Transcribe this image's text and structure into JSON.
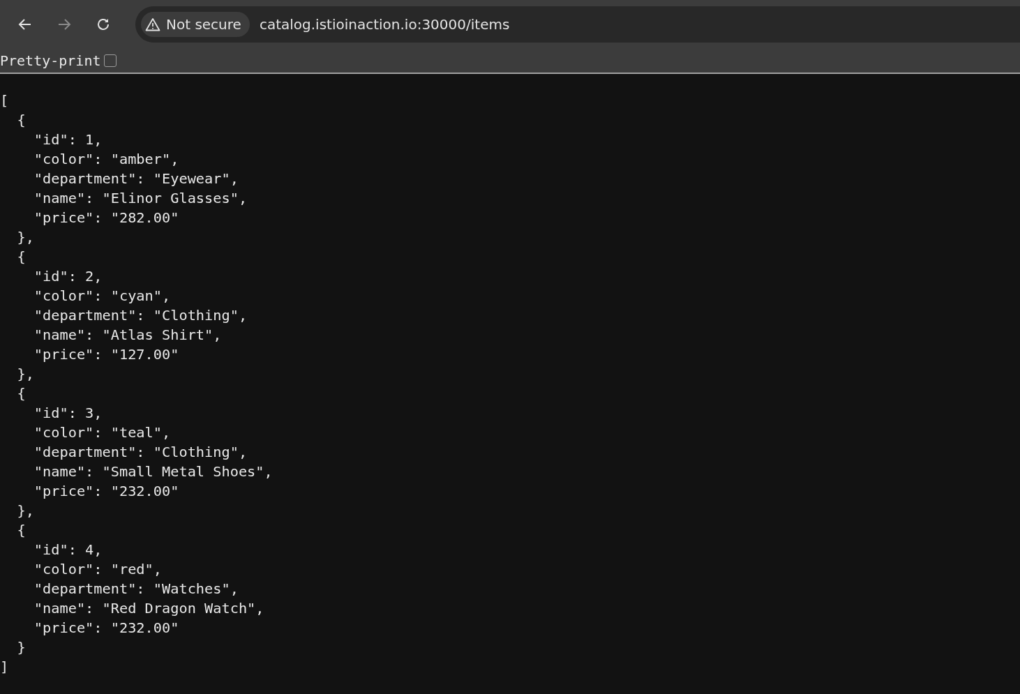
{
  "browser": {
    "security_label": "Not secure",
    "url": "catalog.istioinaction.io:30000/items"
  },
  "pretty_print": {
    "label": "Pretty-print",
    "checked": false
  },
  "json_lines": [
    "[",
    "  {",
    "    \"id\": 1,",
    "    \"color\": \"amber\",",
    "    \"department\": \"Eyewear\",",
    "    \"name\": \"Elinor Glasses\",",
    "    \"price\": \"282.00\"",
    "  },",
    "  {",
    "    \"id\": 2,",
    "    \"color\": \"cyan\",",
    "    \"department\": \"Clothing\",",
    "    \"name\": \"Atlas Shirt\",",
    "    \"price\": \"127.00\"",
    "  },",
    "  {",
    "    \"id\": 3,",
    "    \"color\": \"teal\",",
    "    \"department\": \"Clothing\",",
    "    \"name\": \"Small Metal Shoes\",",
    "    \"price\": \"232.00\"",
    "  },",
    "  {",
    "    \"id\": 4,",
    "    \"color\": \"red\",",
    "    \"department\": \"Watches\",",
    "    \"name\": \"Red Dragon Watch\",",
    "    \"price\": \"232.00\"",
    "  }",
    "]"
  ]
}
